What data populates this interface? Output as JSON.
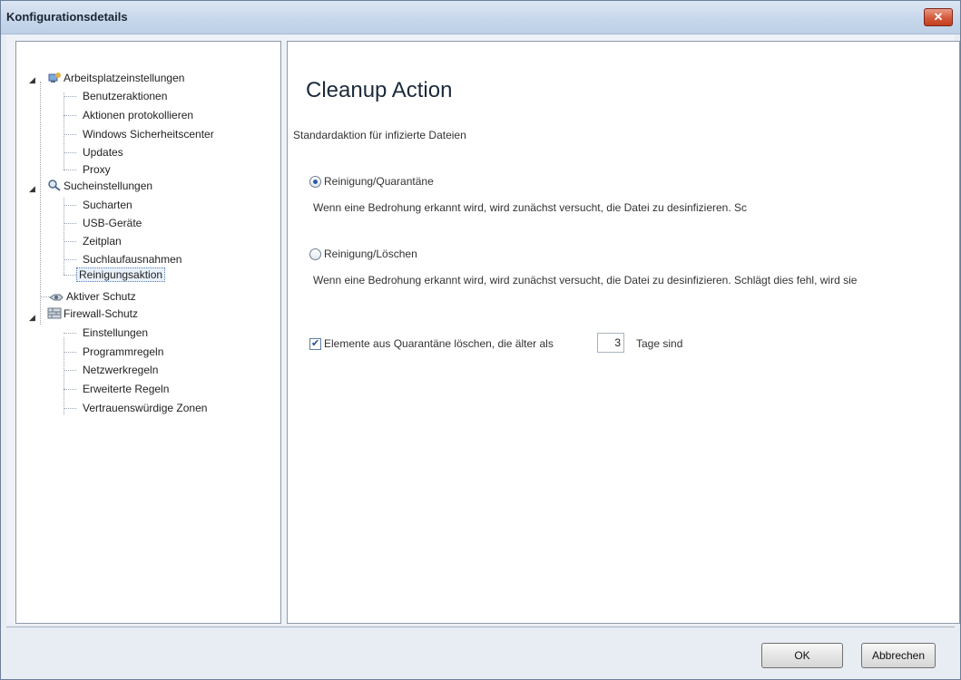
{
  "window": {
    "title": "Konfigurationsdetails"
  },
  "tree": {
    "groups": [
      {
        "label": "Arbeitsplatzeinstellungen",
        "icon": "workstation-icon",
        "children": [
          "Benutzeraktionen",
          "Aktionen protokollieren",
          "Windows Sicherheitscenter",
          "Updates",
          "Proxy"
        ]
      },
      {
        "label": "Sucheinstellungen",
        "icon": "search-settings-icon",
        "children": [
          "Sucharten",
          "USB-Geräte",
          "Zeitplan",
          "Suchlaufausnahmen",
          "Reinigungsaktion"
        ]
      },
      {
        "label": "Aktiver Schutz",
        "icon": "active-protection-icon",
        "children": []
      },
      {
        "label": "Firewall-Schutz",
        "icon": "firewall-icon",
        "children": [
          "Einstellungen",
          "Programmregeln",
          "Netzwerkregeln",
          "Erweiterte Regeln",
          "Vertrauenswürdige Zonen"
        ]
      }
    ],
    "selected": "Reinigungsaktion"
  },
  "content": {
    "heading": "Cleanup Action",
    "default_action_label": "Standardaktion für infizierte Dateien",
    "option1": {
      "label": "Reinigung/Quarantäne",
      "description": "Wenn eine Bedrohung erkannt wird, wird zunächst versucht, die Datei zu desinfizieren. Sc",
      "selected": true
    },
    "option2": {
      "label": "Reinigung/Löschen",
      "description": "Wenn eine Bedrohung erkannt wird, wird zunächst versucht, die Datei zu desinfizieren. Schlägt dies fehl, wird sie",
      "selected": false
    },
    "delete_quarantine": {
      "label": "Elemente aus Quarantäne löschen, die älter als",
      "days": "3",
      "suffix": "Tage sind",
      "checked": true
    }
  },
  "buttons": {
    "ok": "OK",
    "cancel": "Abbrechen"
  }
}
